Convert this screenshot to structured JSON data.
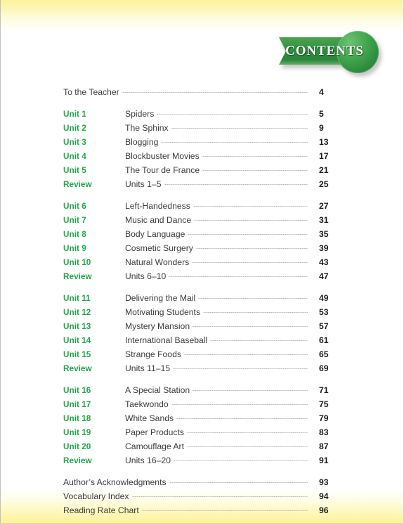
{
  "banner": {
    "label": "CONTENTS",
    "accent_color": "#2e8b3f"
  },
  "colors": {
    "unit_green": "#22a84a",
    "title_gray": "#3c3c41",
    "page_number": "#1c1c22",
    "band_yellow": "#fcf39a"
  },
  "toc": {
    "groups": [
      {
        "rows": [
          {
            "unit": "",
            "title": "To the Teacher",
            "page": "4"
          }
        ]
      },
      {
        "rows": [
          {
            "unit": "Unit 1",
            "title": "Spiders",
            "page": "5"
          },
          {
            "unit": "Unit 2",
            "title": "The Sphinx",
            "page": "9"
          },
          {
            "unit": "Unit 3",
            "title": "Blogging",
            "page": "13"
          },
          {
            "unit": "Unit 4",
            "title": "Blockbuster Movies",
            "page": "17"
          },
          {
            "unit": "Unit 5",
            "title": "The Tour de France",
            "page": "21"
          },
          {
            "unit": "Review",
            "title": "Units 1–5",
            "page": "25"
          }
        ]
      },
      {
        "rows": [
          {
            "unit": "Unit 6",
            "title": "Left-Handedness",
            "page": "27"
          },
          {
            "unit": "Unit 7",
            "title": "Music and Dance",
            "page": "31"
          },
          {
            "unit": "Unit 8",
            "title": "Body Language",
            "page": "35"
          },
          {
            "unit": "Unit 9",
            "title": "Cosmetic Surgery",
            "page": "39"
          },
          {
            "unit": "Unit 10",
            "title": "Natural Wonders",
            "page": "43"
          },
          {
            "unit": "Review",
            "title": "Units 6–10",
            "page": "47"
          }
        ]
      },
      {
        "rows": [
          {
            "unit": "Unit 11",
            "title": "Delivering the Mail",
            "page": "49"
          },
          {
            "unit": "Unit 12",
            "title": "Motivating Students",
            "page": "53"
          },
          {
            "unit": "Unit 13",
            "title": "Mystery Mansion",
            "page": "57"
          },
          {
            "unit": "Unit 14",
            "title": "International Baseball",
            "page": "61"
          },
          {
            "unit": "Unit 15",
            "title": "Strange Foods",
            "page": "65"
          },
          {
            "unit": "Review",
            "title": "Units 11–15",
            "page": "69"
          }
        ]
      },
      {
        "rows": [
          {
            "unit": "Unit 16",
            "title": "A Special Station",
            "page": "71"
          },
          {
            "unit": "Unit 17",
            "title": "Taekwondo",
            "page": "75"
          },
          {
            "unit": "Unit 18",
            "title": "White Sands",
            "page": "79"
          },
          {
            "unit": "Unit 19",
            "title": "Paper Products",
            "page": "83"
          },
          {
            "unit": "Unit 20",
            "title": "Camouflage Art",
            "page": "87"
          },
          {
            "unit": "Review",
            "title": "Units 16–20",
            "page": "91"
          }
        ]
      },
      {
        "rows": [
          {
            "unit": "",
            "title": "Author’s Acknowledgments",
            "page": "93"
          },
          {
            "unit": "",
            "title": "Vocabulary Index",
            "page": "94"
          },
          {
            "unit": "",
            "title": "Reading Rate Chart",
            "page": "96"
          }
        ]
      }
    ]
  }
}
